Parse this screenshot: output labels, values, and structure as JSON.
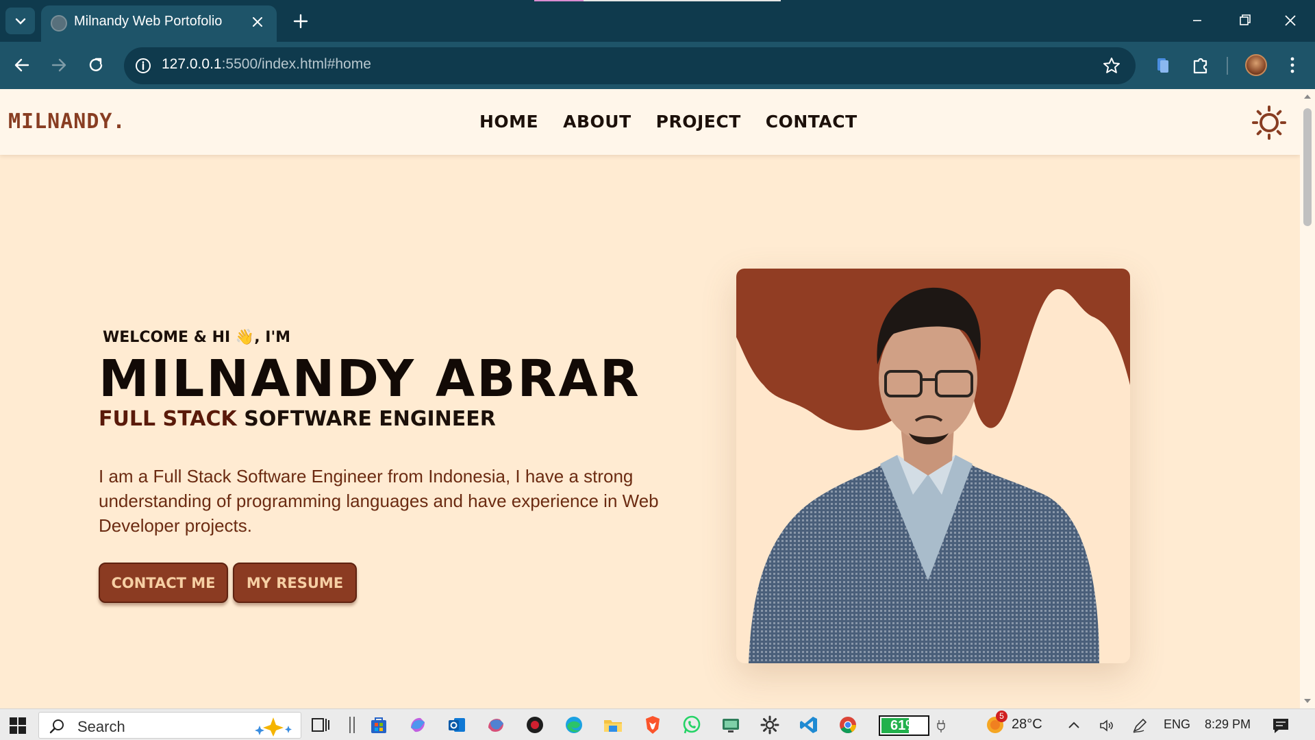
{
  "browser": {
    "tab_title": "Milnandy Web Portofolio",
    "url_host": "127.0.0.1",
    "url_rest": ":5500/index.html#home"
  },
  "site": {
    "logo": "MILNANDY.",
    "nav": [
      "HOME",
      "ABOUT",
      "PROJECT",
      "CONTACT"
    ],
    "greeting": "WELCOME & HI 👋, I'M",
    "name": "MILNANDY ABRAR",
    "role_part1": "FULL STACK",
    "role_part2": "SOFTWARE ENGINEER",
    "bio": "I am a Full Stack Software Engineer from Indonesia, I have a strong understanding of programming languages and have experience in Web Developer projects.",
    "buttons": {
      "contact": "CONTACT ME",
      "resume": "MY RESUME"
    },
    "accent_color": "#8b3b22",
    "background_color": "#ffebd2"
  },
  "taskbar": {
    "search_placeholder": "Search",
    "battery": "61%",
    "battery_level": 0.61,
    "weather_badge": "5",
    "temperature": "28°C",
    "language": "ENG",
    "time": "8:29 PM"
  }
}
